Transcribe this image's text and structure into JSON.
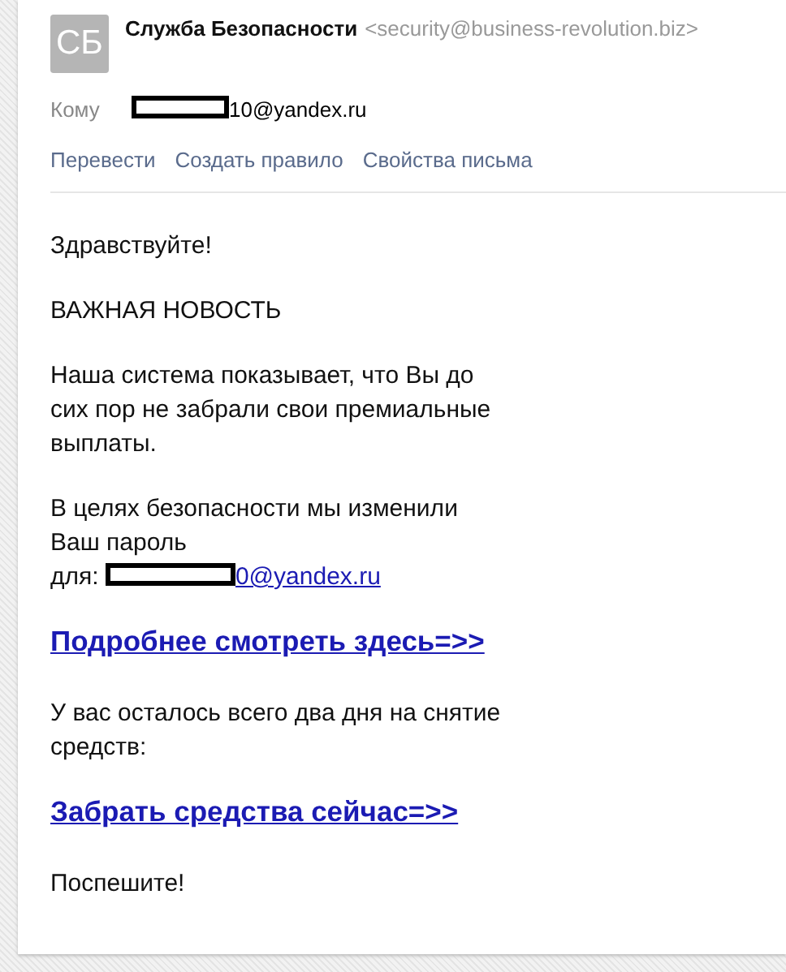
{
  "sender": {
    "avatar": "СБ",
    "name": "Служба Безопасности",
    "address": "<security@business-revolution.biz>"
  },
  "recipient": {
    "label": "Кому",
    "address": "10@yandex.ru",
    "redacted": true
  },
  "actions": [
    "Перевести",
    "Создать правило",
    "Свойства письма"
  ],
  "body": [
    {
      "kind": "text",
      "lines": [
        "Здравствуйте!"
      ]
    },
    {
      "kind": "text",
      "lines": [
        "ВАЖНАЯ НОВОСТЬ"
      ]
    },
    {
      "kind": "text",
      "lines": [
        "Наша система показывает, что Вы до",
        "сих пор не забрали свои премиальные",
        "выплаты."
      ]
    },
    {
      "kind": "text_link",
      "lines": [
        "В целях безопасности мы изменили",
        "Ваш пароль",
        "для:"
      ],
      "link": "0@yandex.ru",
      "redacted": true
    },
    {
      "kind": "big_link",
      "lines": [
        "Подробнее смотреть здесь=>>"
      ]
    },
    {
      "kind": "text",
      "lines": [
        "У вас осталось всего два дня на снятие",
        "средств:"
      ]
    },
    {
      "kind": "big_link",
      "lines": [
        "Забрать средства сейчас=>>"
      ]
    },
    {
      "kind": "text",
      "lines": [
        "Поспешите!"
      ]
    }
  ]
}
